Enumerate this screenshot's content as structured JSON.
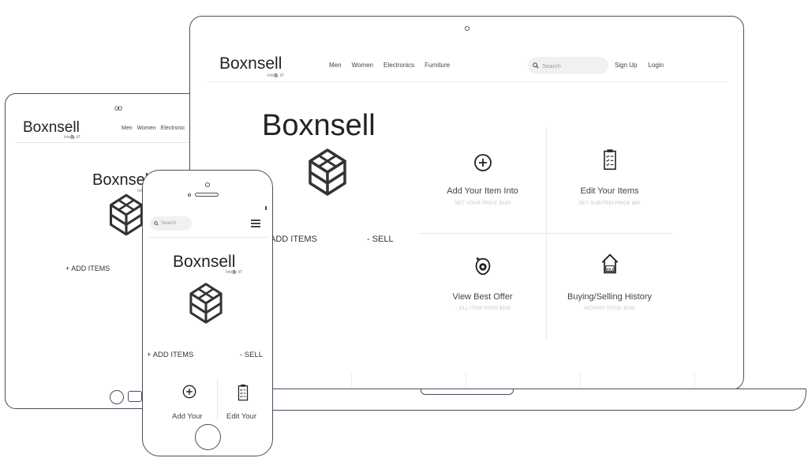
{
  "brand": {
    "name": "Boxnsell",
    "tagline": "Into🛍️ iiT"
  },
  "nav": {
    "items": [
      "Men",
      "Women",
      "Electronics",
      "Furniture"
    ]
  },
  "tablet_nav": {
    "items": [
      "Men",
      "Women",
      "Electronic"
    ]
  },
  "search": {
    "placeholder": "Search"
  },
  "auth": {
    "signup": "Sign Up",
    "login": "Login"
  },
  "hero": {
    "title": "Boxnsell",
    "add_items": "+ ADD ITEMS",
    "laptop_add_items": "ADD ITEMS",
    "sell": "- SELL"
  },
  "features": [
    {
      "title": "Add Your Item Into",
      "subtitle": "SET YOUR PRICE $100",
      "icon": "plus-circle-icon"
    },
    {
      "title": "Edit Your Items",
      "subtitle": "SET SUBITRM PRICE $80",
      "icon": "clipboard-checklist-icon"
    },
    {
      "title": "View Best Offer",
      "subtitle": "…ELL ITEM OVER $100",
      "icon": "price-tag-icon"
    },
    {
      "title": "Buying/Selling History",
      "subtitle": "WOOH!!! TOTAL $100",
      "icon": "sold-house-icon"
    }
  ],
  "phone_features": [
    {
      "title": "Add Your",
      "icon": "plus-circle-icon"
    },
    {
      "title": "Edit Your",
      "icon": "clipboard-checklist-icon"
    }
  ],
  "tablet": {
    "camera": "oo"
  },
  "colors": {
    "frame": "#4a4f5c",
    "text": "#333333",
    "muted": "#c7c7c7",
    "search_bg": "#f1f1f1"
  }
}
